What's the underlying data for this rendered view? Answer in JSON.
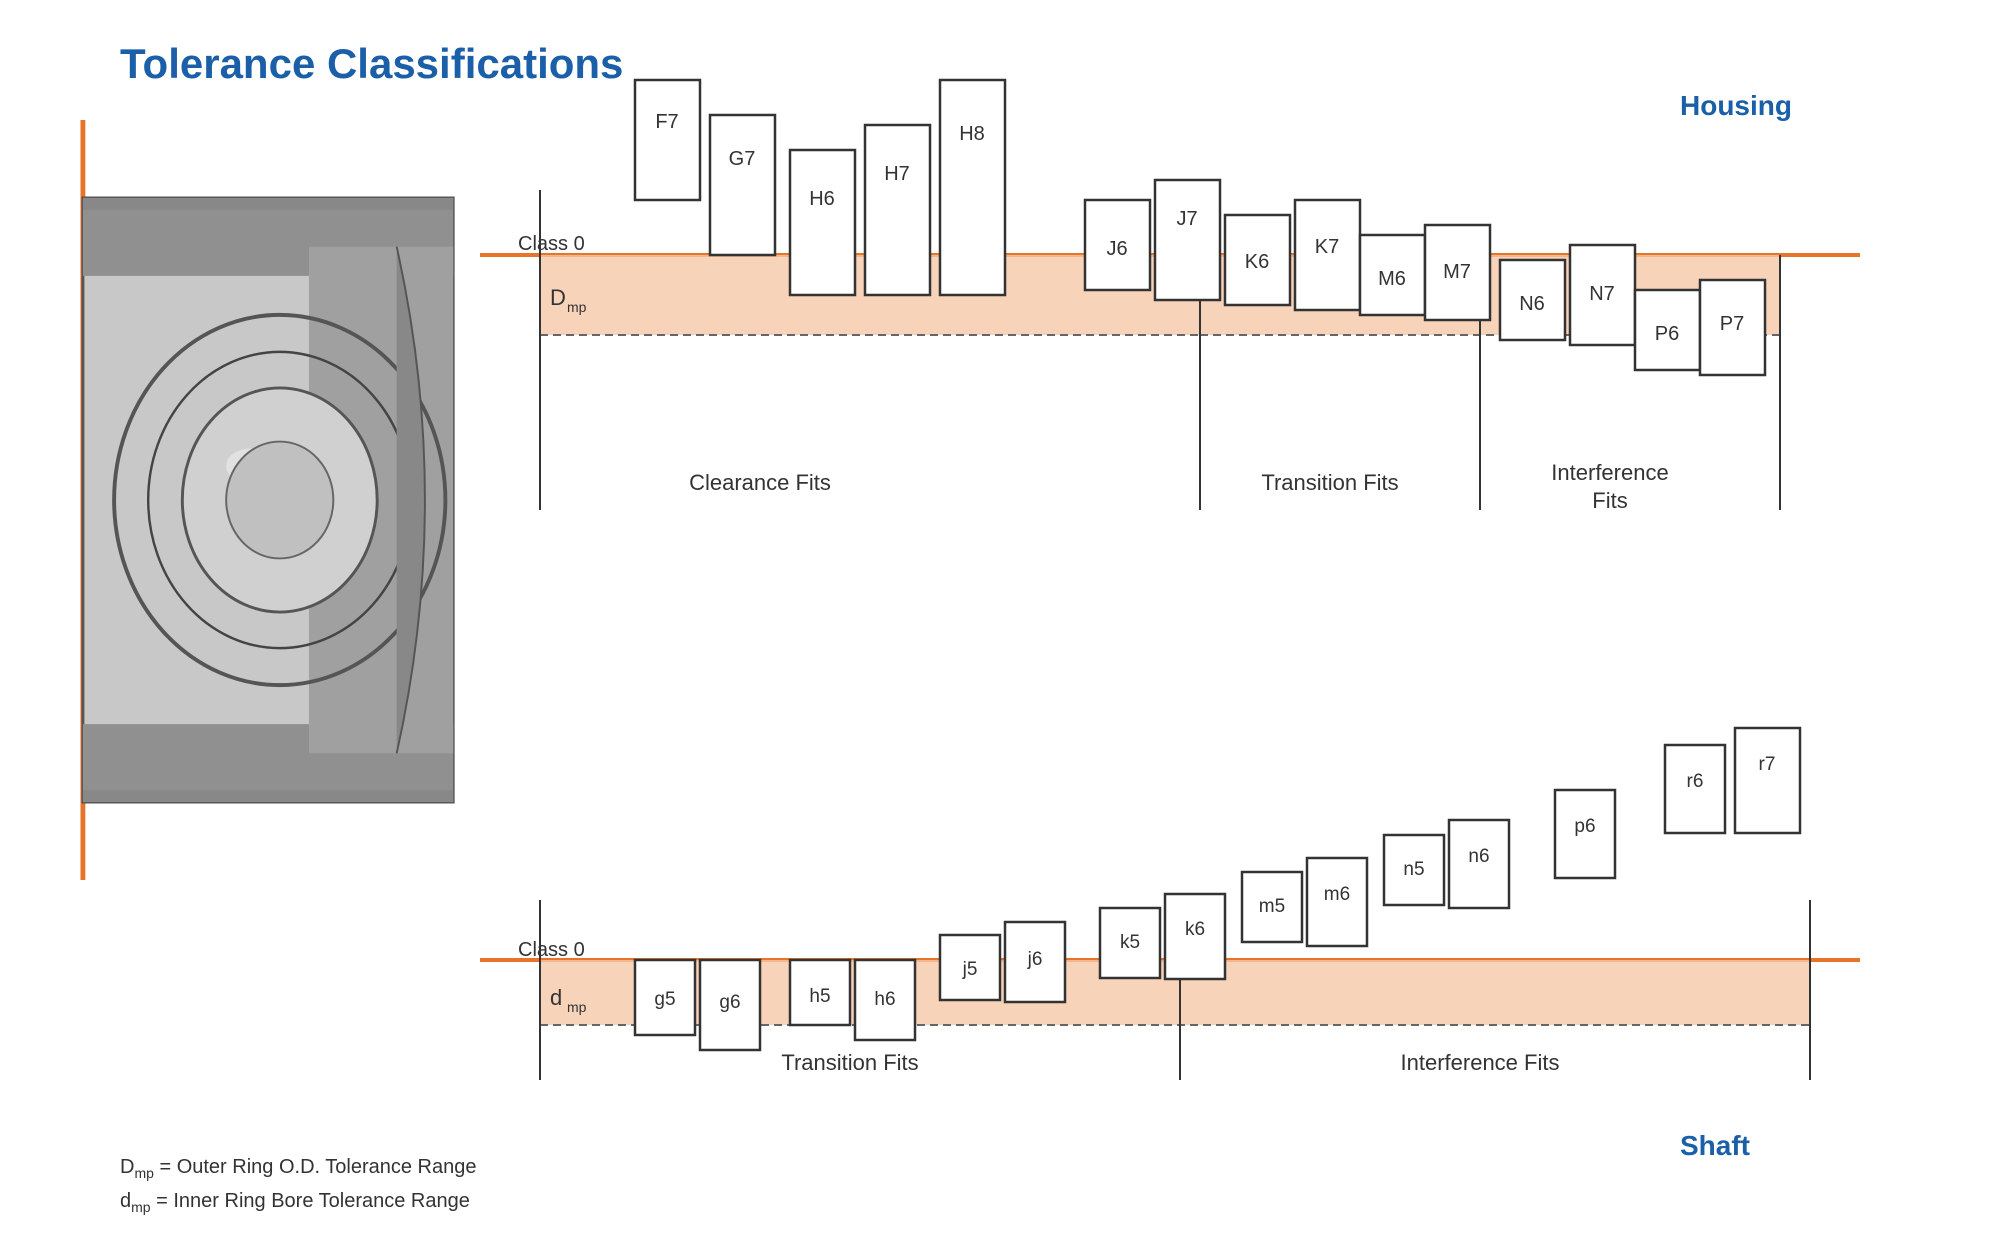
{
  "title": "Tolerance Classifications",
  "housing_label": "Housing",
  "shaft_label": "Shaft",
  "class0_label": "Class 0",
  "Dmp_label": "D",
  "Dmp_sub": "mp",
  "dmp_label": "d",
  "dmp_sub": "mp",
  "clearance_fits": "Clearance Fits",
  "transition_fits": "Transition Fits",
  "interference_fits": "Interference Fits",
  "legend1": "D  = Outer Ring O.D. Tolerance Range",
  "legend1_sub": "mp",
  "legend2": "d  = Inner Ring Bore Tolerance Range",
  "legend2_sub": "mp",
  "housing_codes": [
    "F7",
    "G7",
    "H6",
    "H7",
    "H8",
    "J6",
    "J7",
    "K6",
    "K7",
    "M6",
    "M7",
    "N6",
    "N7",
    "P6",
    "P7"
  ],
  "shaft_codes": [
    "g5",
    "g6",
    "h5",
    "h6",
    "j5",
    "j6",
    "k5",
    "k6",
    "m5",
    "m6",
    "n5",
    "n6",
    "p6",
    "r6",
    "r7"
  ]
}
